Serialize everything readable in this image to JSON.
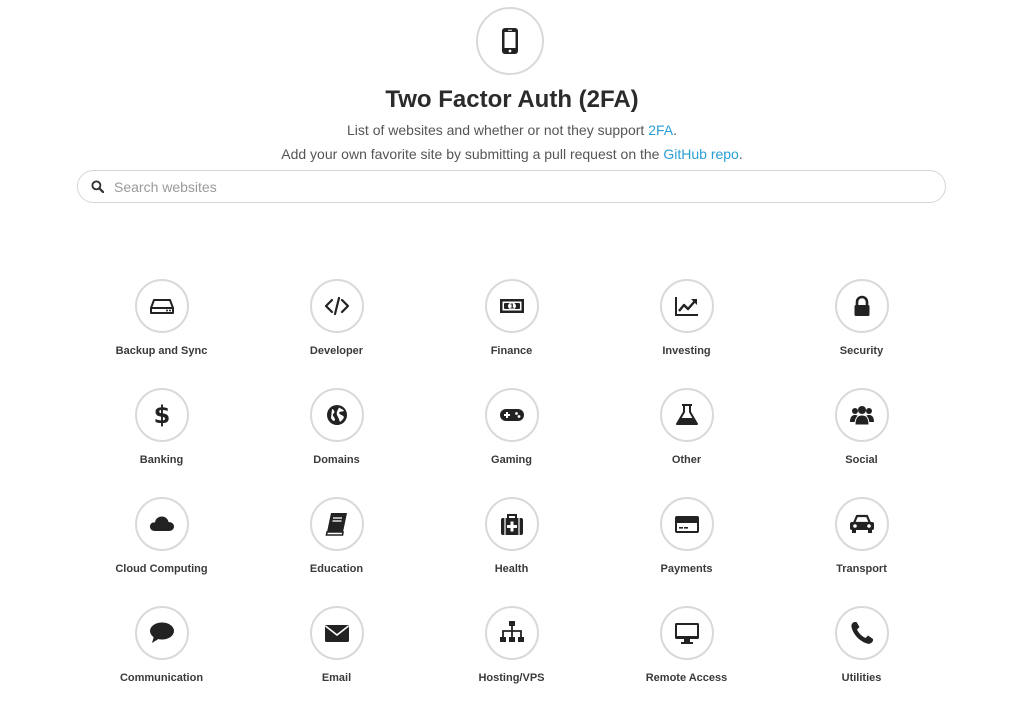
{
  "header": {
    "logo_icon": "smartphone-icon",
    "title": "Two Factor Auth (2FA)",
    "line1_text": "List of websites and whether or not they support ",
    "line1_link": "2FA",
    "line1_end": ".",
    "line2_text": "Add your own favorite site by submitting a pull request on the ",
    "line2_link": "GitHub repo",
    "line2_end": ".",
    "link_color": "#2a9fd6"
  },
  "search": {
    "icon": "search-icon",
    "placeholder": "Search websites",
    "value": ""
  },
  "categories": [
    {
      "label": "Backup and Sync",
      "icon": "hard-drive-icon"
    },
    {
      "label": "Developer",
      "icon": "code-icon"
    },
    {
      "label": "Finance",
      "icon": "money-icon"
    },
    {
      "label": "Investing",
      "icon": "line-chart-icon"
    },
    {
      "label": "Security",
      "icon": "lock-icon"
    },
    {
      "label": "Banking",
      "icon": "dollar-icon"
    },
    {
      "label": "Domains",
      "icon": "globe-icon"
    },
    {
      "label": "Gaming",
      "icon": "gamepad-icon"
    },
    {
      "label": "Other",
      "icon": "flask-icon"
    },
    {
      "label": "Social",
      "icon": "users-icon"
    },
    {
      "label": "Cloud Computing",
      "icon": "cloud-icon"
    },
    {
      "label": "Education",
      "icon": "book-icon"
    },
    {
      "label": "Health",
      "icon": "medkit-icon"
    },
    {
      "label": "Payments",
      "icon": "credit-card-icon"
    },
    {
      "label": "Transport",
      "icon": "car-icon"
    },
    {
      "label": "Communication",
      "icon": "comment-icon"
    },
    {
      "label": "Email",
      "icon": "envelope-icon"
    },
    {
      "label": "Hosting/VPS",
      "icon": "sitemap-icon"
    },
    {
      "label": "Remote Access",
      "icon": "desktop-icon"
    },
    {
      "label": "Utilities",
      "icon": "phone-icon"
    }
  ]
}
